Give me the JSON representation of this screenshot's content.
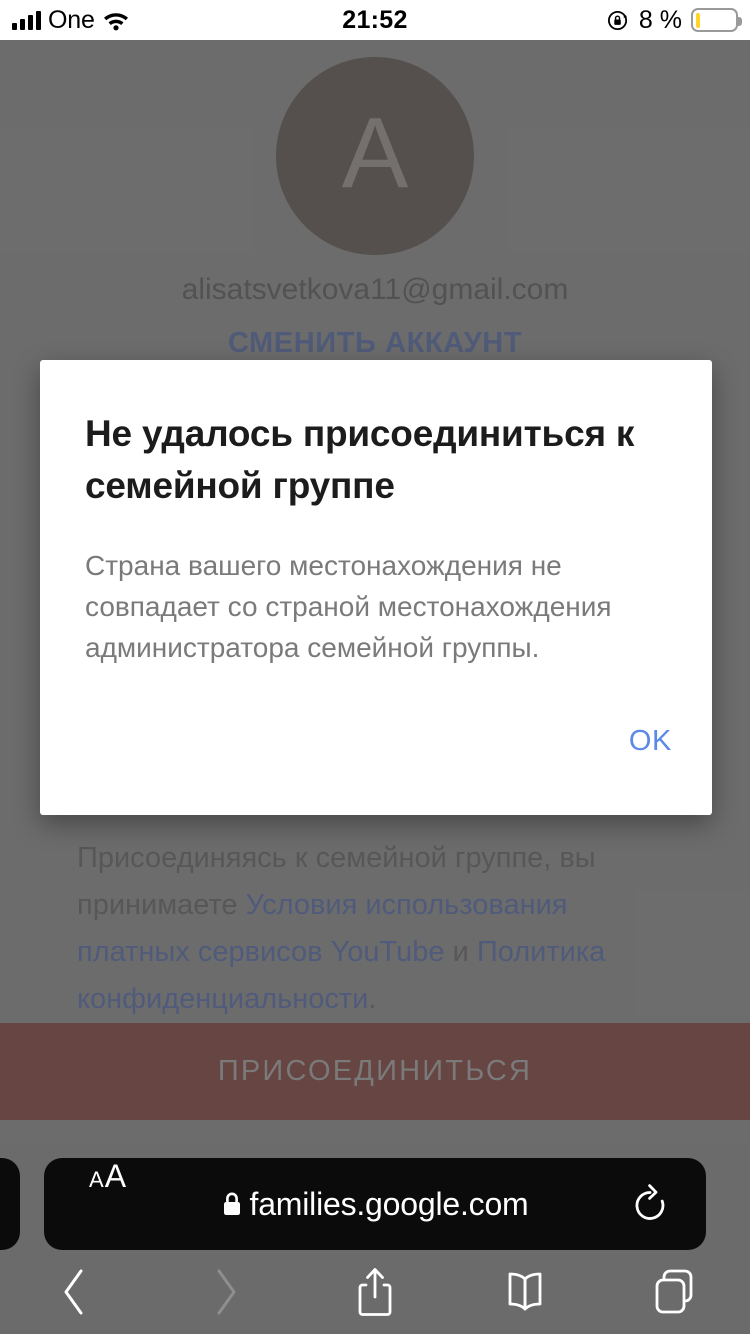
{
  "status_bar": {
    "carrier": "One",
    "signal_icon": "cellular-signal-icon",
    "wifi_icon": "wifi-icon",
    "time": "21:52",
    "orientation_lock_icon": "rotation-lock-icon",
    "battery_percent": "8 %",
    "battery_level": 8,
    "battery_color": "#ffd426"
  },
  "page": {
    "avatar": {
      "initial": "A",
      "background_color": "#453a35",
      "text_color": "#8d8580"
    },
    "email": "alisatsvetkova11@gmail.com",
    "switch_account_label": "СМЕНИТЬ АККАУНТ",
    "switch_account_color": "#39539b",
    "terms": {
      "part1": "Присоединяясь к семейной группе, вы принимаете ",
      "link1": "Условия использования платных сервисов YouTube",
      "part2": " и ",
      "link2": "Политика конфиденциальности",
      "part3": ".",
      "link_color": "#3b55a0"
    },
    "join_button_label": "ПРИСОЕДИНИТЬСЯ",
    "join_button_color": "#6e2019"
  },
  "dialog": {
    "title": "Не удалось присоединиться к семейной группе",
    "body": "Страна вашего местонахождения не совпадает со страной местонахождения администратора семейной группы.",
    "ok_label": "OK",
    "ok_color": "#5c88e8"
  },
  "browser": {
    "text_size_small": "A",
    "text_size_large": "A",
    "lock_icon": "lock-icon",
    "url": "families.google.com",
    "reload_icon": "reload-icon",
    "toolbar": {
      "back_icon": "chevron-left-icon",
      "forward_icon": "chevron-right-icon",
      "share_icon": "share-icon",
      "bookmarks_icon": "book-icon",
      "tabs_icon": "tabs-icon"
    }
  }
}
